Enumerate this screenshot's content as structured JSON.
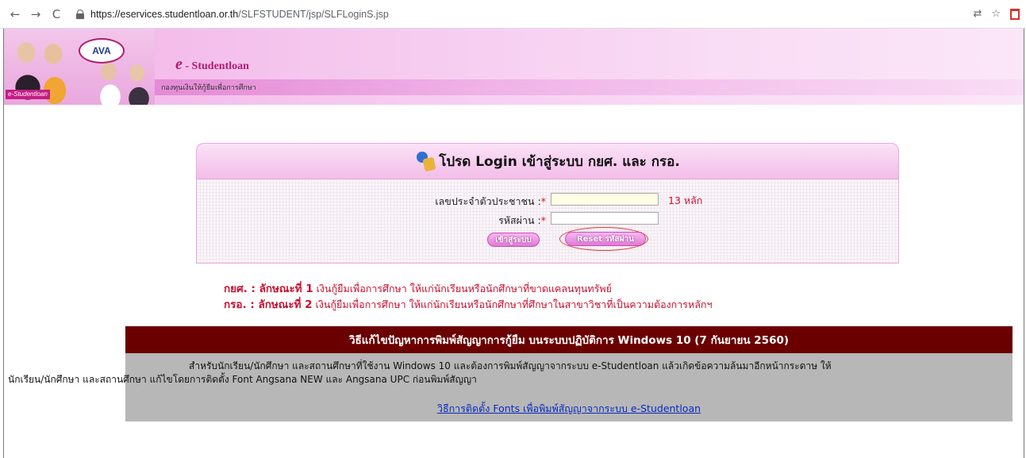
{
  "browser": {
    "back": "←",
    "forward": "→",
    "reload": "C",
    "url_host": "https://eservices.studentloan.or.th",
    "url_path": "/SLFSTUDENT/jsp/SLFLoginS.jsp",
    "translate_icon": "translate-icon",
    "star": "☆"
  },
  "banner": {
    "logo_text": "AVA",
    "photo_tag": "e-Studentloan",
    "title_e": "e",
    "title_rest": " - Studentloan",
    "subtitle": "กองทุนเงินให้กู้ยืมเพื่อการศึกษา"
  },
  "login": {
    "title": "โปรด Login เข้าสู่ระบบ กยศ. และ กรอ.",
    "id_label": "เลขประจำตัวประชาชน  :",
    "id_required": "*",
    "id_value": "",
    "id_note": "13 หลัก",
    "password_label": "รหัสผ่าน  :",
    "password_required": "*",
    "password_value": "",
    "login_button": "เข้าสู่ระบบ",
    "reset_button": "Reset รหัสผ่าน"
  },
  "info": {
    "line1_bold": "กยศ. : ลักษณะที่ 1",
    "line1_text": "  เงินกู้ยืมเพื่อการศึกษา ให้แก่นักเรียนหรือนักศึกษาที่ขาดแคลนทุนทรัพย์",
    "line2_bold": "กรอ. : ลักษณะที่ 2",
    "line2_text": "  เงินกู้ยืมเพื่อการศึกษา ให้แก่นักเรียนหรือนักศึกษาที่ศึกษาในสาขาวิชาที่เป็นความต้องการหลักฯ"
  },
  "notice": {
    "title": "วิธีแก้ไขปัญหาการพิมพ์สัญญาการกู้ยืม บนระบบปฏิบัติการ Windows 10 (7 กันยายน 2560)",
    "line1": "สำหรับนักเรียน/นักศึกษา และสถานศึกษาที่ใช้งาน Windows 10 และต้องการพิมพ์สัญญาจากระบบ e-Studentloan แล้วเกิดข้อความล้นมาอีกหน้ากระดาษ ให้",
    "line2": "นักเรียน/นักศึกษา และสถานศึกษา แก้ไขโดยการติดตั้ง Font Angsana NEW และ Angsana UPC ก่อนพิมพ์สัญญา",
    "link": "วิธีการติดตั้ง Fonts เพื่อพิมพ์สัญญาจากระบบ e-Studentloan"
  },
  "colors": {
    "banner_pink": "#f5c6ee",
    "required_red": "#e01010",
    "notice_header": "#6b0000",
    "notice_body": "#b7b7b7",
    "link_blue": "#0a2bbf"
  }
}
